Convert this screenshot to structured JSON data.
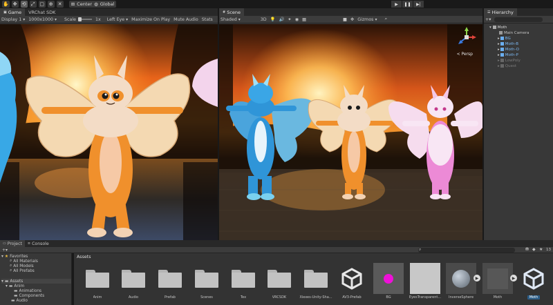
{
  "toolbar": {
    "pivot_label": "Center",
    "rotation_label": "Global"
  },
  "game_panel": {
    "tabs": [
      {
        "label": "Game"
      },
      {
        "label": "VRChat SDK"
      }
    ],
    "display": "Display 1",
    "resolution": "1000x1000",
    "scale_label": "Scale",
    "scale_value": "1x",
    "eye": "Left Eye",
    "maximize": "Maximize On Play",
    "mute": "Mute Audio",
    "stats": "Stats"
  },
  "scene_panel": {
    "tab": "Scene",
    "shading": "Shaded",
    "mode_2d_3d": "3D",
    "gizmos": "Gizmos",
    "perspective": "< Persp",
    "axis_x": "x",
    "axis_z": "z",
    "axis_y": "y"
  },
  "hierarchy": {
    "tab": "Hierarchy",
    "items": [
      {
        "label": "Moth",
        "level": 0,
        "color": "#dddddd"
      },
      {
        "label": "Main Camera",
        "level": 1,
        "color": "#c4c4c4"
      },
      {
        "label": "BG",
        "level": 1,
        "color": "#7bb7f0"
      },
      {
        "label": "Moth-B",
        "level": 1,
        "color": "#7bb7f0"
      },
      {
        "label": "Moth-O",
        "level": 1,
        "color": "#7bb7f0"
      },
      {
        "label": "Moth-P",
        "level": 1,
        "color": "#7bb7f0"
      },
      {
        "label": "LowPoly",
        "level": 1,
        "color": "#7a7a7a"
      },
      {
        "label": "Quest",
        "level": 1,
        "color": "#7a7a7a"
      }
    ]
  },
  "project": {
    "tabs": [
      {
        "label": "Project"
      },
      {
        "label": "Console"
      }
    ],
    "breadcrumb": "Assets",
    "hidden_count": "13",
    "favorites": {
      "label": "Favorites",
      "items": [
        "All Materials",
        "All Models",
        "All Prefabs"
      ]
    },
    "tree": {
      "root": "Assets",
      "items": [
        {
          "label": "Anim",
          "level": 1
        },
        {
          "label": "Animations",
          "level": 2
        },
        {
          "label": "Components",
          "level": 2
        },
        {
          "label": "Audio",
          "level": 1
        }
      ]
    },
    "assets": [
      {
        "label": "Anim",
        "kind": "folder"
      },
      {
        "label": "Audio",
        "kind": "folder"
      },
      {
        "label": "Prefab",
        "kind": "folder"
      },
      {
        "label": "Scenes",
        "kind": "folder"
      },
      {
        "label": "Tex",
        "kind": "folder"
      },
      {
        "label": "VRCSDK",
        "kind": "folder"
      },
      {
        "label": "Xiexes-Unity-Sha...",
        "kind": "folder"
      },
      {
        "label": "AV3-Prefab",
        "kind": "unity-icon"
      },
      {
        "label": "BG",
        "kind": "material-magenta"
      },
      {
        "label": "EyesTransparent...",
        "kind": "material-grey"
      },
      {
        "label": "InverseSphere",
        "kind": "model-sphere"
      },
      {
        "label": "Moth",
        "kind": "model-grey"
      },
      {
        "label": "Moth",
        "kind": "unity-icon-selected"
      }
    ]
  }
}
